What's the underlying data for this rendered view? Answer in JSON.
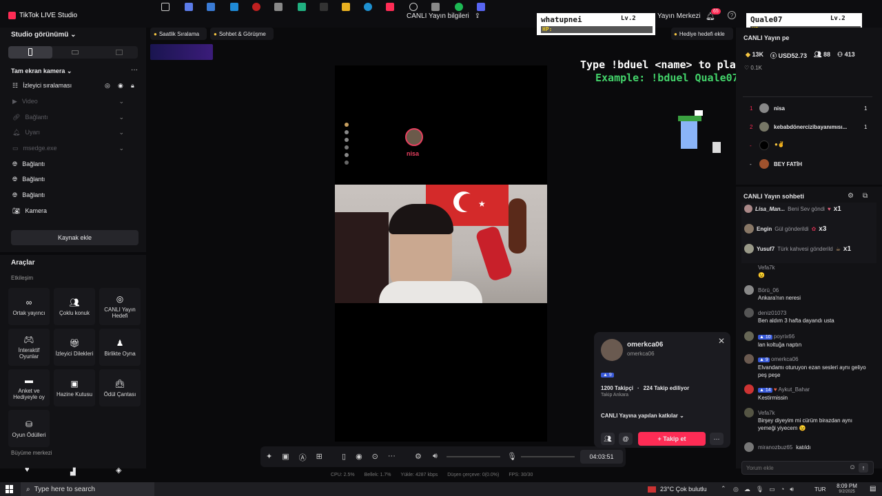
{
  "app": {
    "title": "TikTok LIVE Studio",
    "live_info": "CANLI Yayın bilgileri",
    "live_center": "Yayın Merkezi",
    "notif_count": "65"
  },
  "sidebar": {
    "studio_view": "Studio görünümü",
    "scene_title": "Tam ekran kamera",
    "sources": [
      {
        "label": "İzleyici sıralaması",
        "icon": "list-icon",
        "dim": false
      },
      {
        "label": "Video",
        "icon": "video-icon",
        "dim": true
      },
      {
        "label": "Bağlantı",
        "icon": "link-icon",
        "dim": true
      },
      {
        "label": "Uyarı",
        "icon": "alert-icon",
        "dim": true
      },
      {
        "label": "msedge.exe",
        "icon": "window-icon",
        "dim": true
      },
      {
        "label": "Bağlantı",
        "icon": "globe-icon",
        "dim": false
      },
      {
        "label": "Bağlantı",
        "icon": "globe-icon",
        "dim": false
      },
      {
        "label": "Bağlantı",
        "icon": "globe-icon",
        "dim": false
      },
      {
        "label": "Kamera",
        "icon": "camera-icon",
        "dim": false
      }
    ],
    "add_source": "Kaynak ekle",
    "tools_title": "Araçlar",
    "interaction": "Etkileşim",
    "tools": [
      {
        "label": "Ortak yayıncı",
        "icon": "link-icon"
      },
      {
        "label": "Çoklu konuk",
        "icon": "users-icon"
      },
      {
        "label": "CANLI Yayın Hedefi",
        "icon": "target-icon"
      },
      {
        "label": "İnteraktif Oyunlar",
        "icon": "gamepad-icon"
      },
      {
        "label": "İzleyici Dilekleri",
        "icon": "gift-icon"
      },
      {
        "label": "Birlikte Oyna",
        "icon": "play-together-icon"
      },
      {
        "label": "Anket ve Hediyeyle oy",
        "icon": "poll-icon"
      },
      {
        "label": "Hazine Kutusu",
        "icon": "treasure-icon"
      },
      {
        "label": "Ödül Çantası",
        "icon": "bag-icon"
      },
      {
        "label": "Oyun Ödülleri",
        "icon": "reward-icon"
      }
    ],
    "growth": "Büyüme merkezi"
  },
  "topbar": {
    "tab1": "Saatlik Sıralama",
    "tab2": "Sohbet & Görüşme",
    "gift_goal": "Hediye hedefi ekle"
  },
  "overlay": {
    "game_line1": "Type !bduel <name> to play",
    "game_line2": "Example: !bduel Quale07",
    "player1": "whatupnei",
    "player1_lv": "Lv.2",
    "player2": "Quale07",
    "player2_lv": "Lv.2",
    "hp": "HP:",
    "viewer_name": "nisa"
  },
  "stats_top": {
    "likes": "13K",
    "usd": "USD52.73",
    "viewers": "88",
    "followers": "413",
    "partial": "0.1K",
    "live_title_partial": "CANLI Yayın pe"
  },
  "ranking": [
    {
      "rank": "1",
      "name": "nisa",
      "score": "1"
    },
    {
      "rank": "2",
      "name": "kebabdönercizibayanımısı...",
      "score": "1"
    },
    {
      "rank": "-",
      "name": "",
      "score": ""
    },
    {
      "rank": "-",
      "name": "BEY FATİH",
      "score": ""
    }
  ],
  "chat": {
    "title": "CANLI Yayın sohbeti",
    "gifts": [
      {
        "user": "Lisa_Man...",
        "text": "Beni Sev göndi",
        "count": "x1"
      },
      {
        "user": "Engin",
        "text": "Gül gönderildi",
        "count": "x3"
      },
      {
        "user": "Yusuf7",
        "text": "Türk kahvesi gönderild",
        "count": "x1"
      }
    ],
    "messages": [
      {
        "user": "Vefa7k",
        "badge": "",
        "text": "😉"
      },
      {
        "user": "Börü_06",
        "badge": "",
        "text": "Ankara'nın neresi"
      },
      {
        "user": "deniz01073",
        "badge": "",
        "text": "Ben aldım 3 hafta dayandı usta"
      },
      {
        "user": "poyrix66",
        "badge": "10",
        "text": "lan koltuğa naptın"
      },
      {
        "user": "omerkca06",
        "badge": "9",
        "text": "Elvandamı oturuyon ezan sesleri aynı geliyo peş peşe"
      },
      {
        "user": "Aykut_Bahar",
        "badge": "14",
        "text": "Kestirmissin"
      },
      {
        "user": "Vefa7k",
        "badge": "",
        "text": "Birşey diyeyim mi cürüm birazdan aynı yemeği yiyecem 😉"
      },
      {
        "user": "miranozbuz65",
        "badge": "",
        "text": "katıldı"
      }
    ],
    "placeholder": "Yorum ekle"
  },
  "profile": {
    "name": "omerkca06",
    "handle": "omerkca06",
    "badge": "9",
    "followers": "1200 Takipçi",
    "following": "224 Takip ediliyor",
    "location": "Takip Ankara",
    "contrib": "CANLI Yayına yapılan katkılar",
    "follow_btn": "+ Takip et"
  },
  "timer": "04:03:51",
  "stats": {
    "cpu": "CPU: 2.5%",
    "mem": "Bellek: 1.7%",
    "upload": "Yükle: 4287 kbps",
    "dropped": "Düşen çerçeve: 0(0.0%)",
    "fps": "FPS: 30/30"
  },
  "taskbar": {
    "search": "Type here to search",
    "weather": "23°C  Çok bulutlu",
    "lang": "TUR",
    "time": "8:09 PM",
    "date": "9/2/2025"
  }
}
